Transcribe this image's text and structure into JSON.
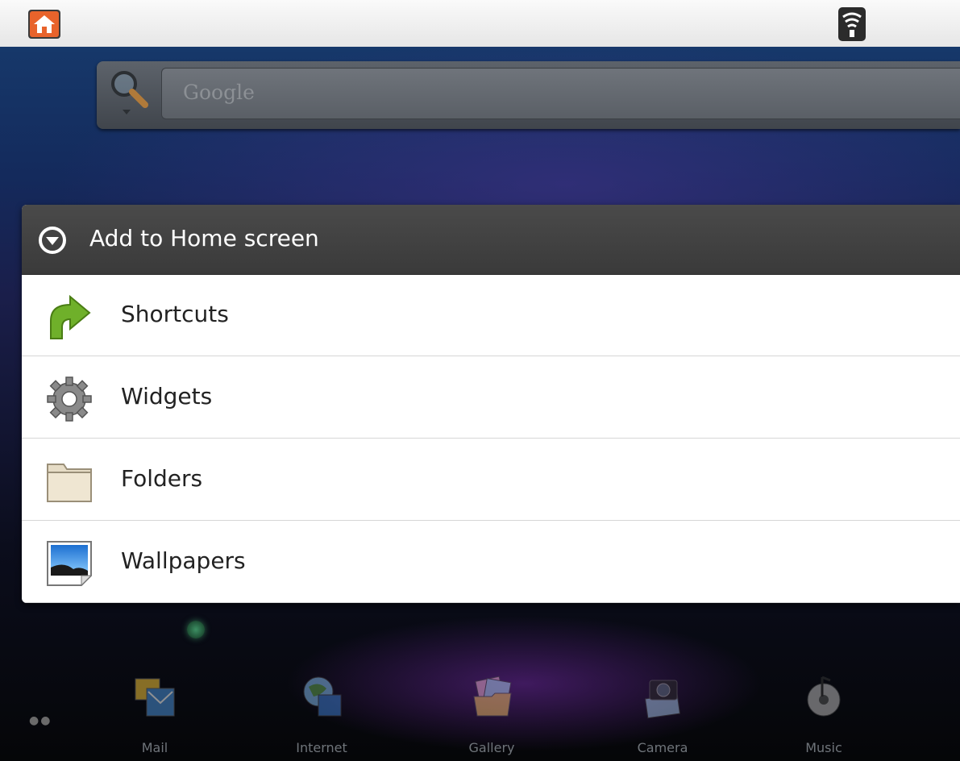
{
  "status_bar": {
    "home_icon": "home-icon",
    "signal_icon": "wifi-signal-icon"
  },
  "search": {
    "placeholder": "Google",
    "icon": "search-icon"
  },
  "dialog": {
    "title": "Add to Home screen",
    "items": [
      {
        "label": "Shortcuts",
        "icon": "shortcut-arrow-icon"
      },
      {
        "label": "Widgets",
        "icon": "gear-icon"
      },
      {
        "label": "Folders",
        "icon": "folder-icon"
      },
      {
        "label": "Wallpapers",
        "icon": "wallpaper-icon"
      }
    ]
  },
  "dock": {
    "items": [
      {
        "label": "Mail",
        "icon": "mail-icon"
      },
      {
        "label": "Internet",
        "icon": "globe-icon"
      },
      {
        "label": "Gallery",
        "icon": "gallery-icon"
      },
      {
        "label": "Camera",
        "icon": "camera-icon"
      },
      {
        "label": "Music",
        "icon": "music-icon"
      }
    ]
  },
  "colors": {
    "dialog_header": "#404040",
    "dialog_body": "#ffffff",
    "status_bar": "#f0f0f0"
  }
}
